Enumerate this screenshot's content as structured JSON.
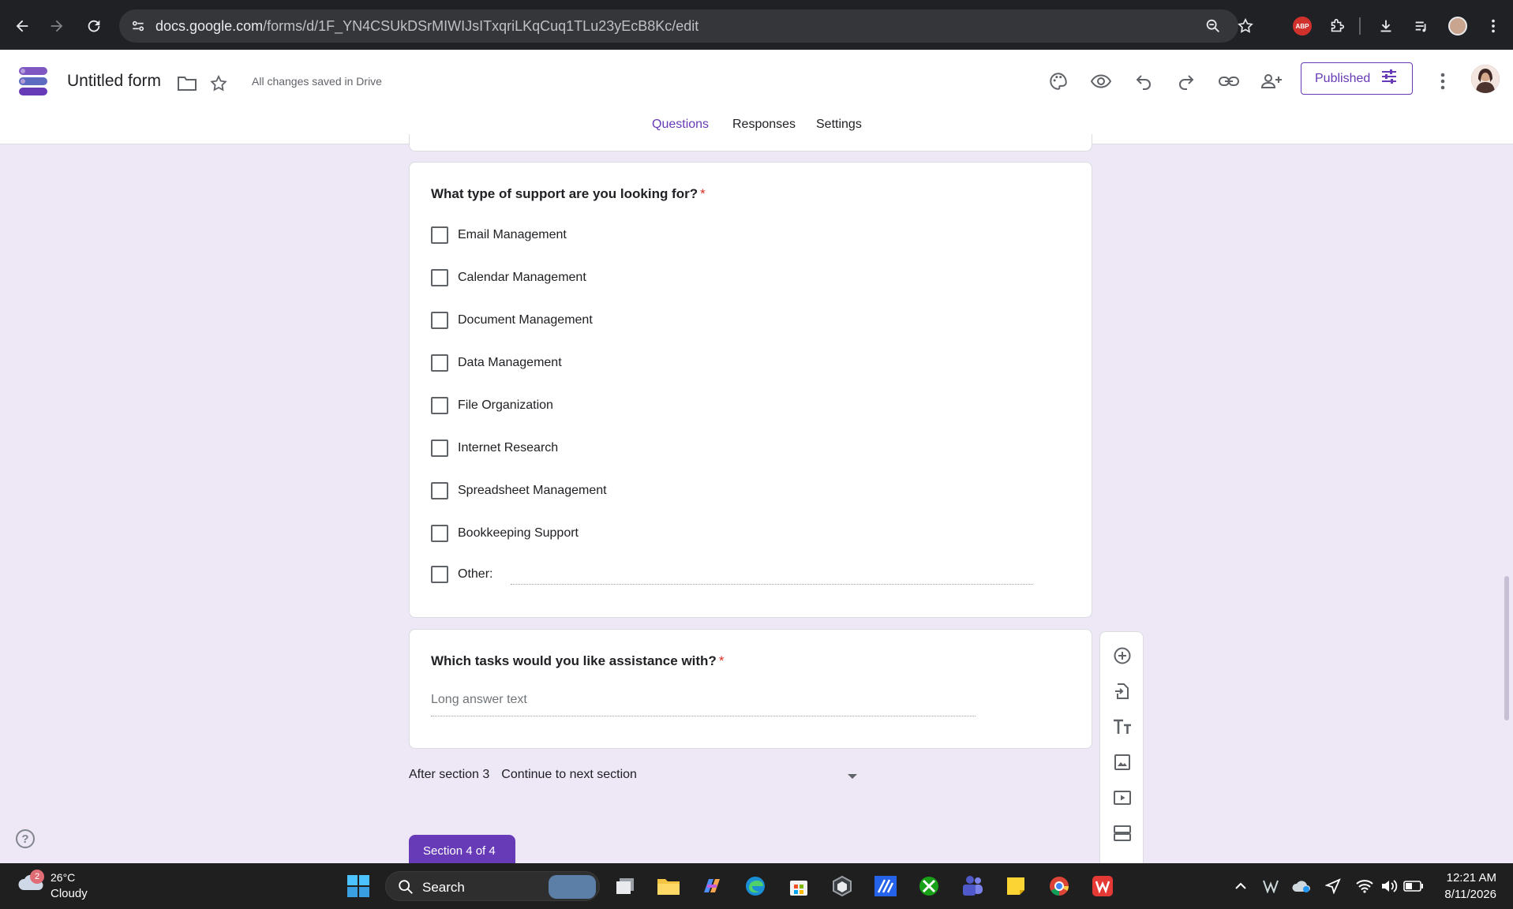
{
  "browser": {
    "url_host": "docs.google.com",
    "url_path": "/forms/d/1F_YN4CSUkDSrMIWIJsITxqriLKqCuq1TLu23yEcB8Kc/edit",
    "abp_label": "ABP"
  },
  "header": {
    "form_title": "Untitled form",
    "save_status": "All changes saved in Drive",
    "publish_label": "Published"
  },
  "tabs": [
    {
      "label": "Questions"
    },
    {
      "label": "Responses"
    },
    {
      "label": "Settings"
    }
  ],
  "questions": [
    {
      "title": "What type of support are you looking for?",
      "required_mark": "*",
      "options": [
        {
          "label": "Email Management"
        },
        {
          "label": "Calendar Management"
        },
        {
          "label": "Document Management"
        },
        {
          "label": "Data Management"
        },
        {
          "label": "File Organization"
        },
        {
          "label": "Internet Research"
        },
        {
          "label": "Spreadsheet Management"
        },
        {
          "label": "Bookkeeping Support"
        },
        {
          "label": "Other:"
        }
      ]
    },
    {
      "title": "Which tasks would you like assistance with?",
      "required_mark": "*",
      "answer_placeholder": "Long answer text"
    }
  ],
  "section_footer": {
    "after_label": "After section 3",
    "action_value": "Continue to next section"
  },
  "next_section_tag": "Section 4 of 4",
  "help_icon_glyph": "?",
  "taskbar": {
    "weather_badge": "2",
    "temperature": "26°C",
    "condition": "Cloudy",
    "search_label": "Search",
    "time": "12:21 AM",
    "date": "8/11/2026"
  },
  "colors": {
    "accent": "#673ab7",
    "page_bg": "#ede7f6",
    "required": "#d93025"
  }
}
